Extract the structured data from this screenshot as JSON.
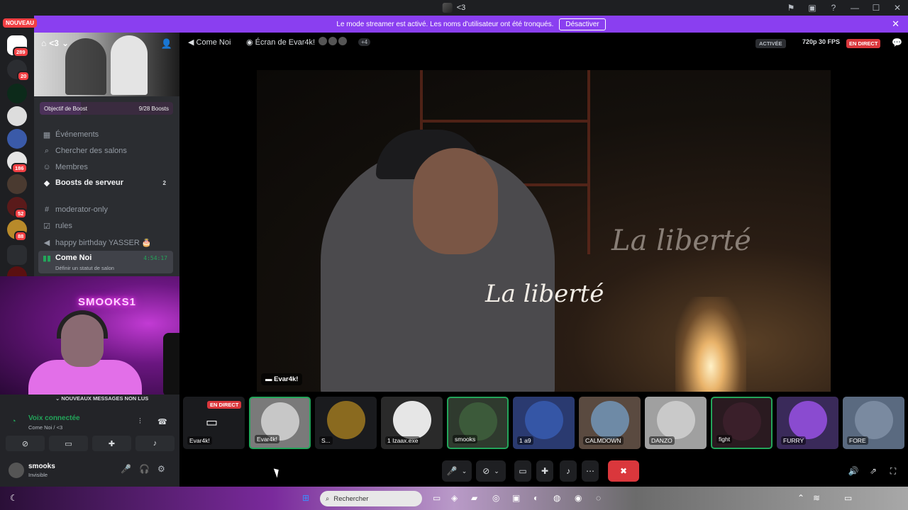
{
  "titlebar": {
    "title": "<3"
  },
  "banner": {
    "text": "Le mode streamer est activé. Les noms d'utilisateur ont été tronqués.",
    "button": "Désactiver"
  },
  "servers": {
    "new_badge": "NOUVEAU",
    "badges": [
      "289",
      "20",
      "186",
      "52",
      "88"
    ]
  },
  "channel_panel": {
    "server_name": "<3",
    "boost_goal": {
      "label": "Objectif de Boost",
      "progress": "9/28 Boosts",
      "progress_fraction": 0.32
    },
    "items": [
      {
        "label": "Événements",
        "icon": "calendar-icon"
      },
      {
        "label": "Chercher des salons",
        "icon": "search-channels-icon"
      },
      {
        "label": "Membres",
        "icon": "members-icon"
      },
      {
        "label": "Boosts de serveur",
        "icon": "boost-icon",
        "count": "2"
      }
    ],
    "channels": [
      {
        "label": "moderator-only",
        "icon": "hash-icon"
      },
      {
        "label": "rules",
        "icon": "rules-icon"
      },
      {
        "label": "happy birthday YASSER 🎂",
        "icon": "speaker-icon"
      }
    ],
    "voice_channel": {
      "name": "Come Noi",
      "status": "Définir un statut de salon",
      "time": "4:54:17"
    }
  },
  "webcam": {
    "neon": "SMOOKS1"
  },
  "lower_panel": {
    "unread": "NOUVEAUX MESSAGES NON LUS",
    "voice_connected": "Voix connectée",
    "voice_sub": "Come Noi / <3",
    "user": {
      "name": "smooks",
      "status": "Invisible"
    }
  },
  "stage": {
    "channel": "Come Noi",
    "screen_title": "Écran de Evar4k!",
    "more": "+4",
    "active": "ACTIVÉE",
    "quality": "720p 30 FPS",
    "live": "EN DIRECT",
    "video_text_1": "La liberté",
    "video_text_2": "La liberté",
    "video_tag": "Evar4k!"
  },
  "tiles": [
    {
      "label": "Evar4k!",
      "live": "EN DIRECT",
      "color": "#1a1b1e"
    },
    {
      "label": "Evar4k!",
      "color": "#c7c7c7"
    },
    {
      "label": "S...",
      "color": "#8a6a1f"
    },
    {
      "label": "1 Izaax.exe",
      "color": "#2a2a2a"
    },
    {
      "label": "smooks",
      "color": "#3c5a3a"
    },
    {
      "label": "1 a9",
      "color": "#3556a6"
    },
    {
      "label": "CALMDOWN",
      "color": "#6e8aa6"
    },
    {
      "label": "DANZO",
      "color": "#c9c9c9"
    },
    {
      "label": "fight",
      "color": "#3a1f2a"
    },
    {
      "label": "FURRY",
      "color": "#8a4bd0"
    },
    {
      "label": "FORE",
      "color": "#7a8aa0"
    }
  ],
  "taskbar": {
    "search_placeholder": "Rechercher"
  }
}
